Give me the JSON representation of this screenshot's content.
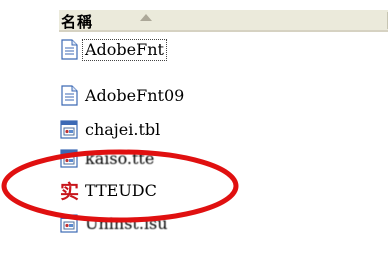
{
  "header": {
    "name_column": "名稱"
  },
  "files": [
    {
      "name": "AdobeFnt",
      "icon": "text-file-icon",
      "focused": true
    },
    {
      "name": "AdobeFnt09",
      "icon": "text-file-icon",
      "focused": false
    },
    {
      "name": "chajei.tbl",
      "icon": "system-file-icon",
      "focused": false
    },
    {
      "name": "kaiso.tte",
      "icon": "system-file-icon",
      "focused": false
    },
    {
      "name": "TTEUDC",
      "icon": "eudc-font-icon",
      "focused": false
    },
    {
      "name": "Uninst.isu",
      "icon": "system-file-icon",
      "focused": false
    }
  ],
  "highlight": {
    "color": "#e01010"
  }
}
